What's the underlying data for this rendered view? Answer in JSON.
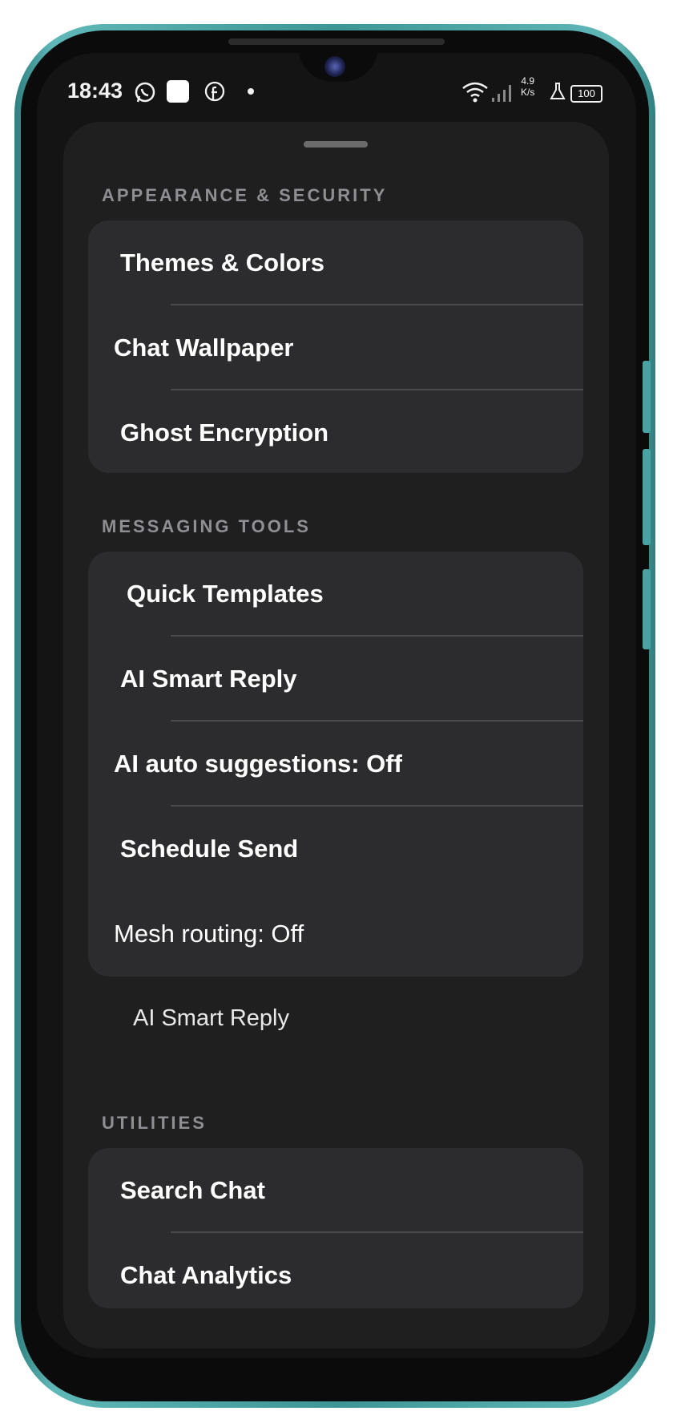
{
  "status_bar": {
    "time": "18:43",
    "net_rate_value": "4.9",
    "net_rate_unit": "K/s",
    "battery": "100",
    "icons": [
      "whatsapp-icon",
      "white-square-icon",
      "facebook-icon",
      "dot-icon",
      "wifi-icon",
      "signal-icon",
      "flask-icon",
      "battery-icon"
    ]
  },
  "sheet": {
    "sections": [
      {
        "title": "APPEARANCE & SECURITY",
        "items": [
          "Themes & Colors",
          "Chat Wallpaper",
          "Ghost Encryption"
        ]
      },
      {
        "title": "MESSAGING TOOLS",
        "items": [
          "Quick Templates",
          "AI Smart Reply",
          "AI auto suggestions: Off",
          "Schedule Send",
          "Mesh routing: Off"
        ]
      },
      {
        "title": "UTILITIES",
        "items": [
          "Search Chat",
          "Chat Analytics"
        ]
      }
    ],
    "loose_item": "AI Smart Reply"
  },
  "colors": {
    "sheet_bg": "#1f1f20",
    "card_bg": "#2c2c2e",
    "section_title": "#8e8e93",
    "frame_accent": "#5fb8b7"
  }
}
